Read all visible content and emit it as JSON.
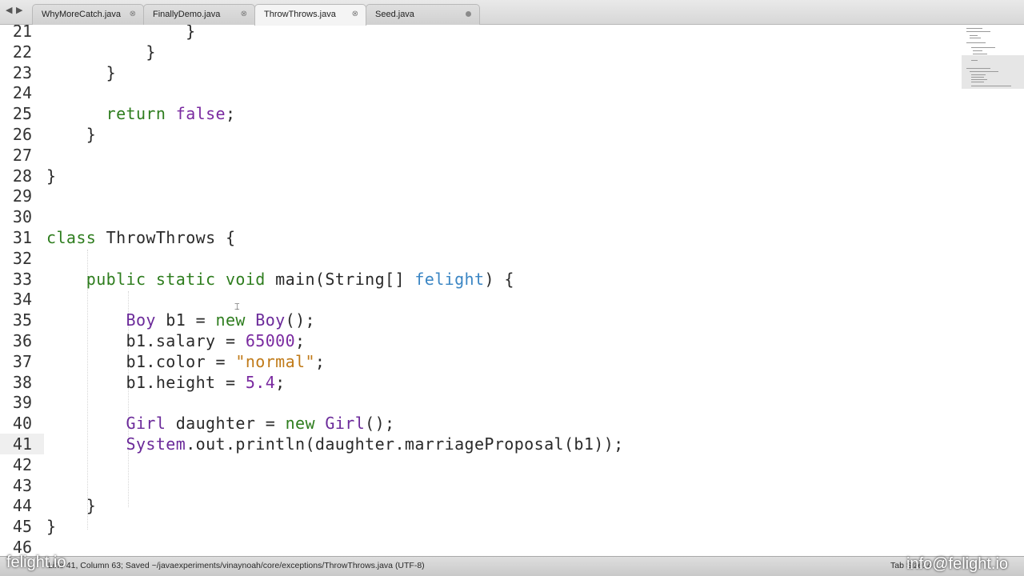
{
  "tabs": [
    {
      "label": "WhyMoreCatch.java",
      "active": false,
      "dirty": false
    },
    {
      "label": "FinallyDemo.java",
      "active": false,
      "dirty": false
    },
    {
      "label": "ThrowThrows.java",
      "active": true,
      "dirty": false
    },
    {
      "label": "Seed.java",
      "active": false,
      "dirty": true
    }
  ],
  "editor": {
    "current_line": 41,
    "lines": [
      {
        "n": "21",
        "code": [
          {
            "t": "              }"
          }
        ]
      },
      {
        "n": "22",
        "code": [
          {
            "t": "          }"
          }
        ]
      },
      {
        "n": "23",
        "code": [
          {
            "t": "      }"
          }
        ]
      },
      {
        "n": "24",
        "code": [
          {
            "t": ""
          }
        ]
      },
      {
        "n": "25",
        "code": [
          {
            "t": "      "
          },
          {
            "t": "return",
            "c": "kw"
          },
          {
            "t": " "
          },
          {
            "t": "false",
            "c": "lit"
          },
          {
            "t": ";"
          }
        ]
      },
      {
        "n": "26",
        "code": [
          {
            "t": "    }"
          }
        ]
      },
      {
        "n": "27",
        "code": [
          {
            "t": ""
          }
        ]
      },
      {
        "n": "28",
        "code": [
          {
            "t": "}"
          }
        ]
      },
      {
        "n": "29",
        "code": [
          {
            "t": ""
          }
        ]
      },
      {
        "n": "30",
        "code": [
          {
            "t": ""
          }
        ]
      },
      {
        "n": "31",
        "code": [
          {
            "t": "class",
            "c": "kw"
          },
          {
            "t": " ThrowThrows {"
          }
        ]
      },
      {
        "n": "32",
        "code": [
          {
            "t": ""
          }
        ]
      },
      {
        "n": "33",
        "code": [
          {
            "t": "    "
          },
          {
            "t": "public static void",
            "c": "kw"
          },
          {
            "t": " main(String[] "
          },
          {
            "t": "felight",
            "c": "param"
          },
          {
            "t": ") {"
          }
        ]
      },
      {
        "n": "34",
        "code": [
          {
            "t": ""
          }
        ]
      },
      {
        "n": "35",
        "code": [
          {
            "t": "        "
          },
          {
            "t": "Boy",
            "c": "type"
          },
          {
            "t": " b1 = "
          },
          {
            "t": "new",
            "c": "kw"
          },
          {
            "t": " "
          },
          {
            "t": "Boy",
            "c": "type"
          },
          {
            "t": "();"
          }
        ]
      },
      {
        "n": "36",
        "code": [
          {
            "t": "        b1.salary = "
          },
          {
            "t": "65000",
            "c": "num"
          },
          {
            "t": ";"
          }
        ]
      },
      {
        "n": "37",
        "code": [
          {
            "t": "        b1.color = "
          },
          {
            "t": "\"normal\"",
            "c": "str"
          },
          {
            "t": ";"
          }
        ]
      },
      {
        "n": "38",
        "code": [
          {
            "t": "        b1.height = "
          },
          {
            "t": "5.4",
            "c": "num"
          },
          {
            "t": ";"
          }
        ]
      },
      {
        "n": "39",
        "code": [
          {
            "t": ""
          }
        ]
      },
      {
        "n": "40",
        "code": [
          {
            "t": "        "
          },
          {
            "t": "Girl",
            "c": "type"
          },
          {
            "t": " daughter = "
          },
          {
            "t": "new",
            "c": "kw"
          },
          {
            "t": " "
          },
          {
            "t": "Girl",
            "c": "type"
          },
          {
            "t": "();"
          }
        ]
      },
      {
        "n": "41",
        "code": [
          {
            "t": "        "
          },
          {
            "t": "System",
            "c": "type"
          },
          {
            "t": ".out.println(daughter.marriageProposal(b1));"
          }
        ]
      },
      {
        "n": "42",
        "code": [
          {
            "t": ""
          }
        ]
      },
      {
        "n": "43",
        "code": [
          {
            "t": ""
          }
        ]
      },
      {
        "n": "44",
        "code": [
          {
            "t": "    }"
          }
        ]
      },
      {
        "n": "45",
        "code": [
          {
            "t": "}"
          }
        ]
      },
      {
        "n": "46",
        "code": [
          {
            "t": ""
          }
        ]
      }
    ]
  },
  "status": {
    "text": "Line 41, Column 63; Saved ~/javaexperiments/vinaynoah/core/exceptions/ThrowThrows.java (UTF-8)",
    "right": "Tab Size: 4"
  },
  "watermark": {
    "left": "felight.io",
    "right": "info@felight.io"
  },
  "icons": {
    "nav_back": "◀",
    "nav_forward": "▶",
    "tab_close": "⊗"
  }
}
